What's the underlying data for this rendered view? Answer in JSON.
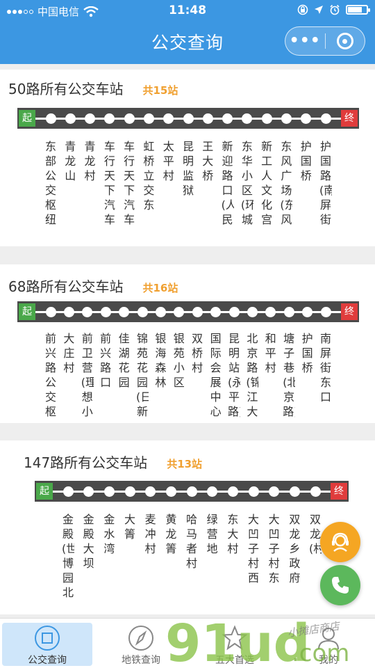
{
  "status_bar": {
    "carrier": "中国电信",
    "time": "11:48"
  },
  "nav": {
    "title": "公交查询",
    "more_label": "•••"
  },
  "routes": [
    {
      "title": "50路所有公交车站",
      "count": "共15站",
      "start_label": "起",
      "end_label": "终",
      "stations": [
        "东部公交枢纽",
        "青龙山",
        "青龙村",
        "车行天下汽车",
        "车行天下汽车",
        "虹桥立交东",
        "太平村",
        "昆明监狱",
        "王大桥",
        "新迎路口(人民",
        "东华小区(环城",
        "新工人文化宫",
        "东风广场(东风",
        "护国桥",
        "护国路(南屏街"
      ]
    },
    {
      "title": "68路所有公交车站",
      "count": "共16站",
      "start_label": "起",
      "end_label": "终",
      "stations": [
        "前兴路公交枢",
        "大庄村",
        "前卫营(理想小",
        "前兴路口",
        "佳湖花园",
        "锦苑花园(日新",
        "银海森林",
        "银苑小区",
        "双桥村",
        "国际会展中心",
        "昆明站(永平路)",
        "北京路(锦江大",
        "和平村",
        "塘子巷(北京路)",
        "护国桥",
        "南屏街东口"
      ]
    },
    {
      "title": "147路所有公交车站",
      "count": "共13站",
      "start_label": "起",
      "end_label": "终",
      "stations": [
        "金殿(世博园北",
        "金殿大坝",
        "金水湾",
        "大箐",
        "麦冲村",
        "黄龙箐",
        "哈马者村",
        "绿营地",
        "东大村",
        "大凹子村西",
        "大凹子村东",
        "双龙乡政府",
        "双龙(村"
      ]
    }
  ],
  "tabs": [
    {
      "label": "公交查询",
      "icon": "bus-square-icon"
    },
    {
      "label": "地铁查询",
      "icon": "compass-icon"
    },
    {
      "label": "五大首选",
      "icon": "star-icon"
    },
    {
      "label": "我的",
      "icon": "person-icon"
    }
  ],
  "floating": {
    "service_icon": "customer-service-icon",
    "phone_icon": "phone-icon"
  },
  "watermark": {
    "text": "91ud.com",
    "shop": "小摊店商店"
  },
  "colors": {
    "nav_blue": "#3c97e2",
    "track": "#4a4a4a",
    "start_green": "#4aa84a",
    "end_red": "#e03c3c",
    "count_orange": "#f0a030",
    "service_orange": "#f5a623",
    "phone_green": "#5cb85c",
    "active_tab_bg": "#cfe6fa"
  }
}
